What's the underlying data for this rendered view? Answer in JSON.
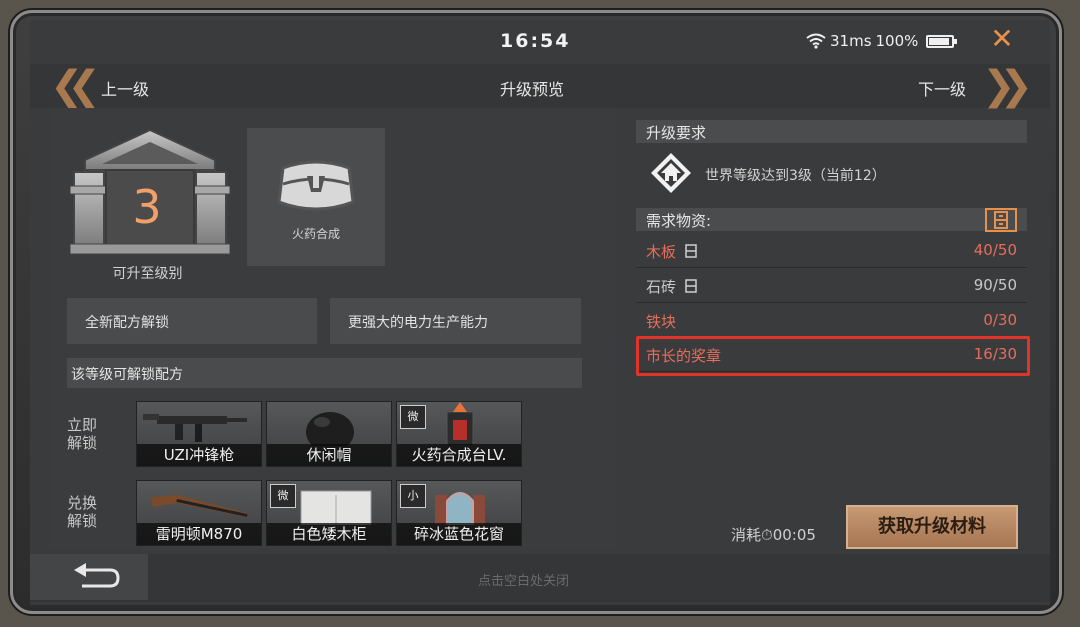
{
  "status_bar": {
    "time": "16:54",
    "ping": "31ms",
    "battery": "100%"
  },
  "header": {
    "prev_label": "上一级",
    "title": "升级预览",
    "next_label": "下一级"
  },
  "level": {
    "number": "3",
    "caption": "可升至级别"
  },
  "recipe": {
    "label": "火药合成"
  },
  "features": [
    "全新配方解锁",
    "更强大的电力生产能力"
  ],
  "unlock_section": {
    "title": "该等级可解锁配方",
    "rows": [
      {
        "label": "立即\n解锁",
        "items": [
          {
            "name": "UZI冲锋枪",
            "tag": ""
          },
          {
            "name": "休闲帽",
            "tag": ""
          },
          {
            "name": "火药合成台LV.",
            "tag": "微"
          }
        ]
      },
      {
        "label": "兑换\n解锁",
        "items": [
          {
            "name": "雷明顿M870",
            "tag": ""
          },
          {
            "name": "白色矮木柜",
            "tag": "微"
          },
          {
            "name": "碎冰蓝色花窗",
            "tag": "小"
          }
        ]
      }
    ]
  },
  "requirements": {
    "title": "升级要求",
    "condition": "世界等级达到3级（当前12）"
  },
  "materials": {
    "title": "需求物资:",
    "rows": [
      {
        "name": "木板",
        "value": "40/50",
        "color": "#e76d5b",
        "sufficient": false
      },
      {
        "name": "石砖",
        "value": "90/50",
        "color": "#c8c8c8",
        "sufficient": true
      },
      {
        "name": "铁块",
        "value": "0/30",
        "color": "#e76d5b",
        "sufficient": false
      },
      {
        "name": "市长的奖章",
        "value": "16/30",
        "color": "#e76d5b",
        "sufficient": false
      }
    ]
  },
  "consume": {
    "label": "消耗",
    "time": "00:05"
  },
  "get_button": {
    "label": "获取升级材料"
  },
  "footer": {
    "hint": "点击空白处关闭"
  },
  "colors": {
    "accent": "#e8914d",
    "highlight": "#e03329",
    "insufficient": "#e76d5b"
  }
}
